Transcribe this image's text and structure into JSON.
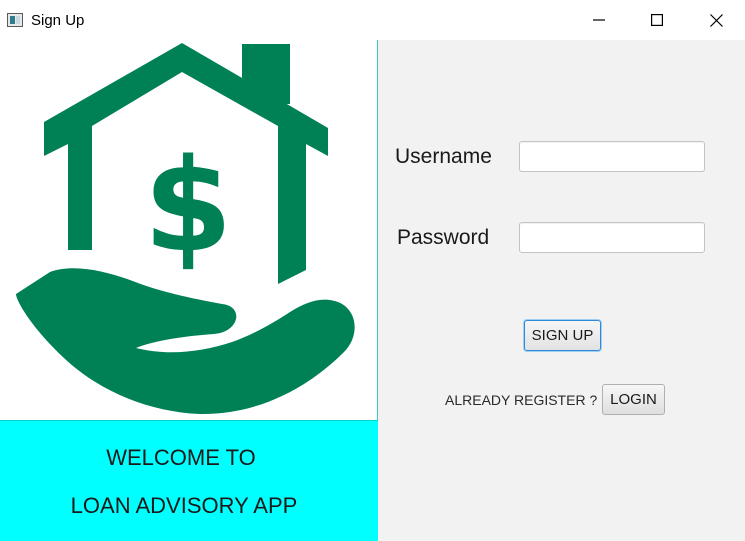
{
  "window": {
    "title": "Sign Up",
    "icon": "app-window-icon",
    "controls": [
      "minimize-icon",
      "maximize-icon",
      "close-icon"
    ]
  },
  "left": {
    "logo": "house-dollar-hand-logo",
    "logo_color": "#008055",
    "welcome_line1": "WELCOME TO",
    "welcome_line2": "LOAN ADVISORY APP",
    "welcome_bg": "#00ffff"
  },
  "form": {
    "username_label": "Username",
    "username_value": "",
    "password_label": "Password",
    "password_value": "",
    "signup_label": "SIGN UP",
    "already_text": "ALREADY REGISTER ?",
    "login_label": "LOGIN",
    "panel_bg": "#f2f2f2"
  }
}
